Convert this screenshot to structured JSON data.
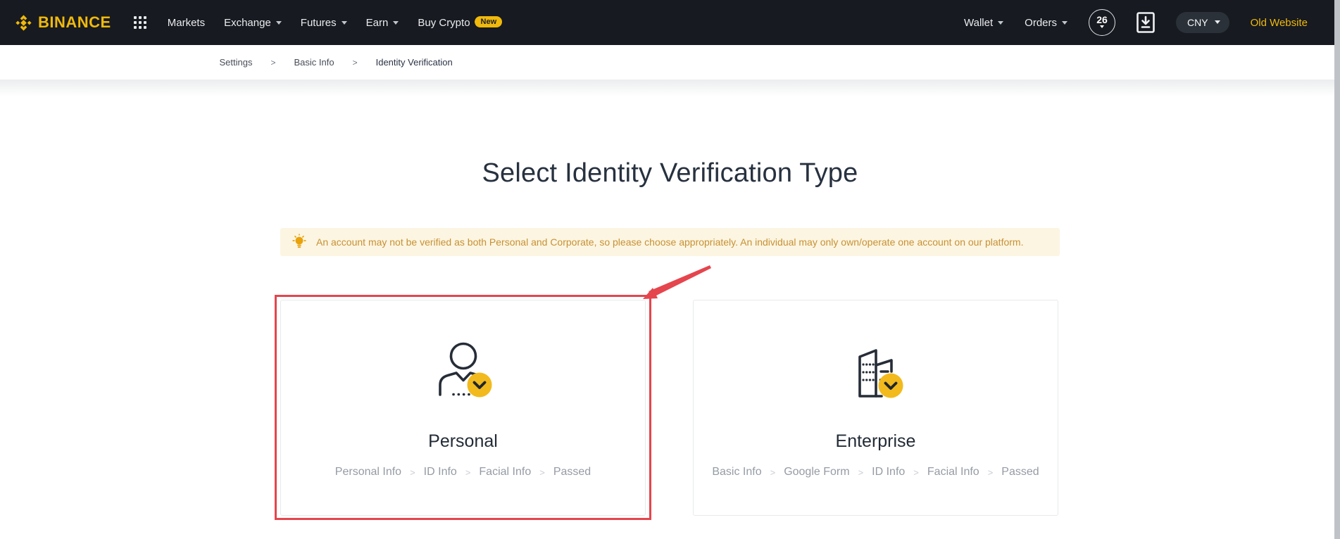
{
  "nav": {
    "logo_text": "BINANCE",
    "menu": [
      {
        "label": "Markets"
      },
      {
        "label": "Exchange"
      },
      {
        "label": "Futures"
      },
      {
        "label": "Earn"
      },
      {
        "label": "Buy Crypto",
        "badge": "New"
      }
    ],
    "right": {
      "wallet": "Wallet",
      "orders": "Orders",
      "notification_count": "26",
      "currency": "CNY",
      "old_website": "Old Website"
    }
  },
  "breadcrumb": {
    "items": [
      "Settings",
      "Basic Info",
      "Identity Verification"
    ],
    "separator": ">"
  },
  "page": {
    "title": "Select Identity Verification Type",
    "notice": "An account may not be verified as both Personal and Corporate, so please choose appropriately. An individual may only own/operate one account on our platform."
  },
  "cards": {
    "separator": ">",
    "personal": {
      "title": "Personal",
      "steps": [
        "Personal Info",
        "ID Info",
        "Facial Info",
        "Passed"
      ]
    },
    "enterprise": {
      "title": "Enterprise",
      "steps": [
        "Basic Info",
        "Google Form",
        "ID Info",
        "Facial Info",
        "Passed"
      ]
    }
  },
  "colors": {
    "brand_yellow": "#f0b90b",
    "nav_bg": "#171a20",
    "notice_bg": "#fcf5e2",
    "notice_text": "#c79133",
    "annotation_red": "#e5454d"
  },
  "icons": {
    "logo": "binance-logo",
    "apps": "apps-grid-icon",
    "download": "download-app-icon",
    "bulb": "lightbulb-icon",
    "personal": "person-verified-icon",
    "enterprise": "building-verified-icon"
  }
}
